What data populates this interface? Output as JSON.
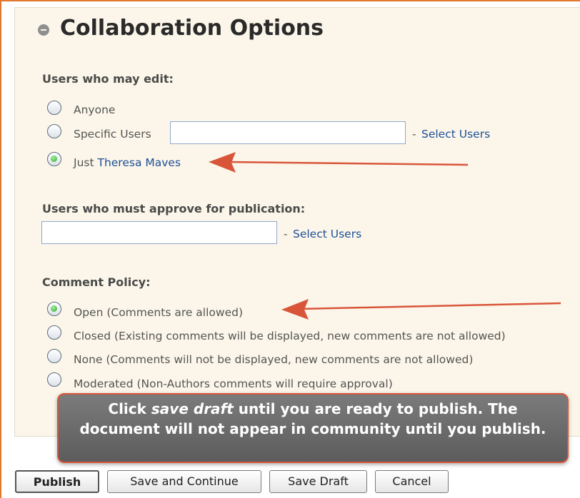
{
  "section": {
    "title": "Collaboration Options",
    "collapse_icon": "minus-circle-icon"
  },
  "editors": {
    "heading": "Users who may edit:",
    "options": [
      {
        "label": "Anyone",
        "checked": false
      },
      {
        "label": "Specific Users",
        "checked": false
      },
      {
        "label_prefix": "Just ",
        "label_name": "Theresa Maves",
        "checked": true
      }
    ],
    "specific_users_value": "",
    "select_sep": "-",
    "select_link": "Select Users"
  },
  "approvers": {
    "heading": "Users who must approve for publication:",
    "input_value": "",
    "select_sep": "-",
    "select_link": "Select Users"
  },
  "comments": {
    "heading": "Comment Policy:",
    "options": [
      {
        "label": "Open (Comments are allowed)",
        "checked": true
      },
      {
        "label": "Closed (Existing comments will be displayed, new comments are not allowed)",
        "checked": false
      },
      {
        "label": "None (Comments will not be displayed, new comments are not allowed)",
        "checked": false
      },
      {
        "label": "Moderated (Non-Authors comments will require approval)",
        "checked": false
      }
    ]
  },
  "callout": {
    "pre": "Click ",
    "em": "save draft",
    "post": " until you are ready to publish. The document will not appear in community until you publish."
  },
  "buttons": {
    "publish": "Publish",
    "save_continue": "Save and Continue",
    "save_draft": "Save Draft",
    "cancel": "Cancel"
  },
  "colors": {
    "frame_border": "#e0782e",
    "panel_bg": "#fbf6e9",
    "link": "#1f4f9a",
    "arrow": "#d9553a",
    "callout_bg": "#6b6b6b"
  }
}
